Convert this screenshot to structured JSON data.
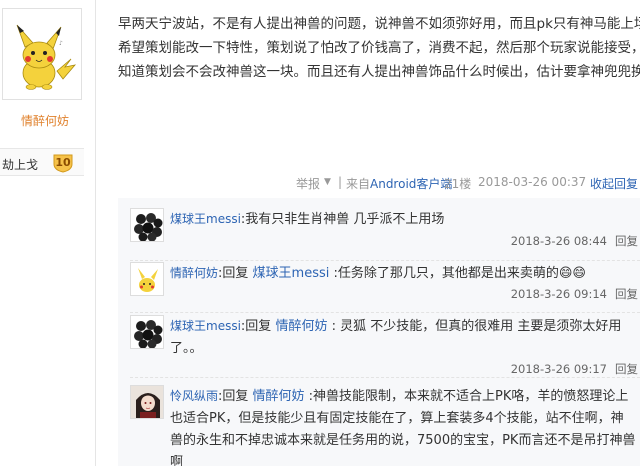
{
  "left_panel": {
    "username": "情醉何妨",
    "honor_label": "劫上戈",
    "level": "10"
  },
  "post": {
    "lines": [
      "早两天宁波站，不是有人提出神兽的问题，说神兽不如须弥好用，而且pk只有神马能上场，",
      "希望策划能改一下特性，策划说了怕改了价钱高了，消费不起，然后那个玩家说能接受，不",
      "知道策划会不会改神兽这一块。而且还有人提出神兽饰品什么时候出，估计要拿神兜兜换。"
    ]
  },
  "meta": {
    "report": "举报",
    "report_caret": "▼",
    "source_prefix": "来自",
    "client": "Android客户端",
    "floor": "21楼",
    "datetime": "2018-03-26 00:37",
    "collapse_reply": "收起回复",
    "separator": "|"
  },
  "replies": [
    {
      "user": "煤球王messi",
      "text": ":我有只非生肖神兽 几乎派不上用场",
      "time": "2018-3-26 08:44",
      "reply_label": "回复"
    },
    {
      "user": "情醉何妨",
      "prefix": ":回复 ",
      "target": "煤球王messi",
      "text": " :任务除了那几只，其他都是出来卖萌的",
      "emoji": "😄😄",
      "time": "2018-3-26 09:14",
      "reply_label": "回复"
    },
    {
      "user": "煤球王messi",
      "prefix": ":回复 ",
      "target": "情醉何妨",
      "text": " : 灵狐 不少技能，但真的很难用 主要是须弥太好用",
      "text_line2": "了。。",
      "time": "2018-3-26 09:17",
      "reply_label": "回复"
    },
    {
      "user": "怜风纵雨",
      "prefix": ":回复 ",
      "target": "情醉何妨",
      "text": " :神兽技能限制，本来就不适合上PK咯，羊的愤怒理论上",
      "text_line2": "也适合PK，但是技能少且有固定技能在了，算上套装多4个技能，站不住啊，神",
      "text_line3": "兽的永生和不掉忠诚本来就是任务用的说，7500的宝宝，PK而言还不是吊打神兽",
      "text_line4": "啊"
    }
  ],
  "colors": {
    "link": "#2d64b3",
    "username": "#e0812c",
    "muted": "#999999",
    "reply_bg": "#f7f8fa"
  }
}
